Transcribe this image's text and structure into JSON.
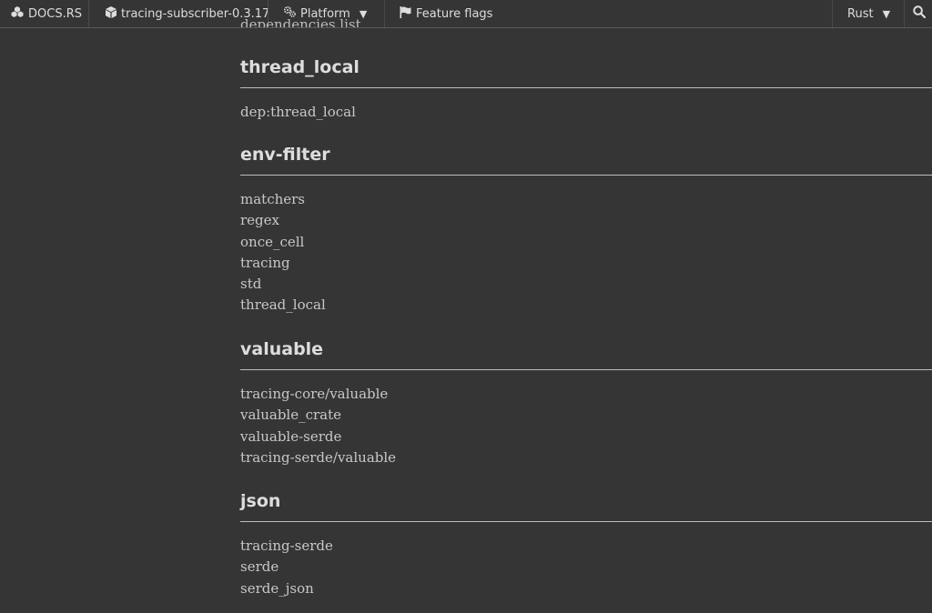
{
  "topbar": {
    "brand_label": "DOCS.RS",
    "crate_label": "tracing-subscriber-0.3.17",
    "platform_label": "Platform",
    "features_label": "Feature flags",
    "language_label": "Rust",
    "icons": {
      "brand": "docsrs-cubes-icon",
      "crate": "cube-icon",
      "platform": "gears-icon",
      "features": "flag-icon",
      "search": "search-icon",
      "dropdown": "caret-down-icon"
    }
  },
  "content": {
    "clipped_text": "dependencies list",
    "sections": [
      {
        "title": "thread_local",
        "items": [
          "dep:thread_local"
        ]
      },
      {
        "title": "env-filter",
        "items": [
          "matchers",
          "regex",
          "once_cell",
          "tracing",
          "std",
          "thread_local"
        ]
      },
      {
        "title": "valuable",
        "items": [
          "tracing-core/valuable",
          "valuable_crate",
          "valuable-serde",
          "tracing-serde/valuable"
        ]
      },
      {
        "title": "json",
        "items": [
          "tracing-serde",
          "serde",
          "serde_json"
        ]
      }
    ]
  },
  "colors": {
    "background": "#353535",
    "text": "#dddddd",
    "divider": "#bdbdbd"
  }
}
